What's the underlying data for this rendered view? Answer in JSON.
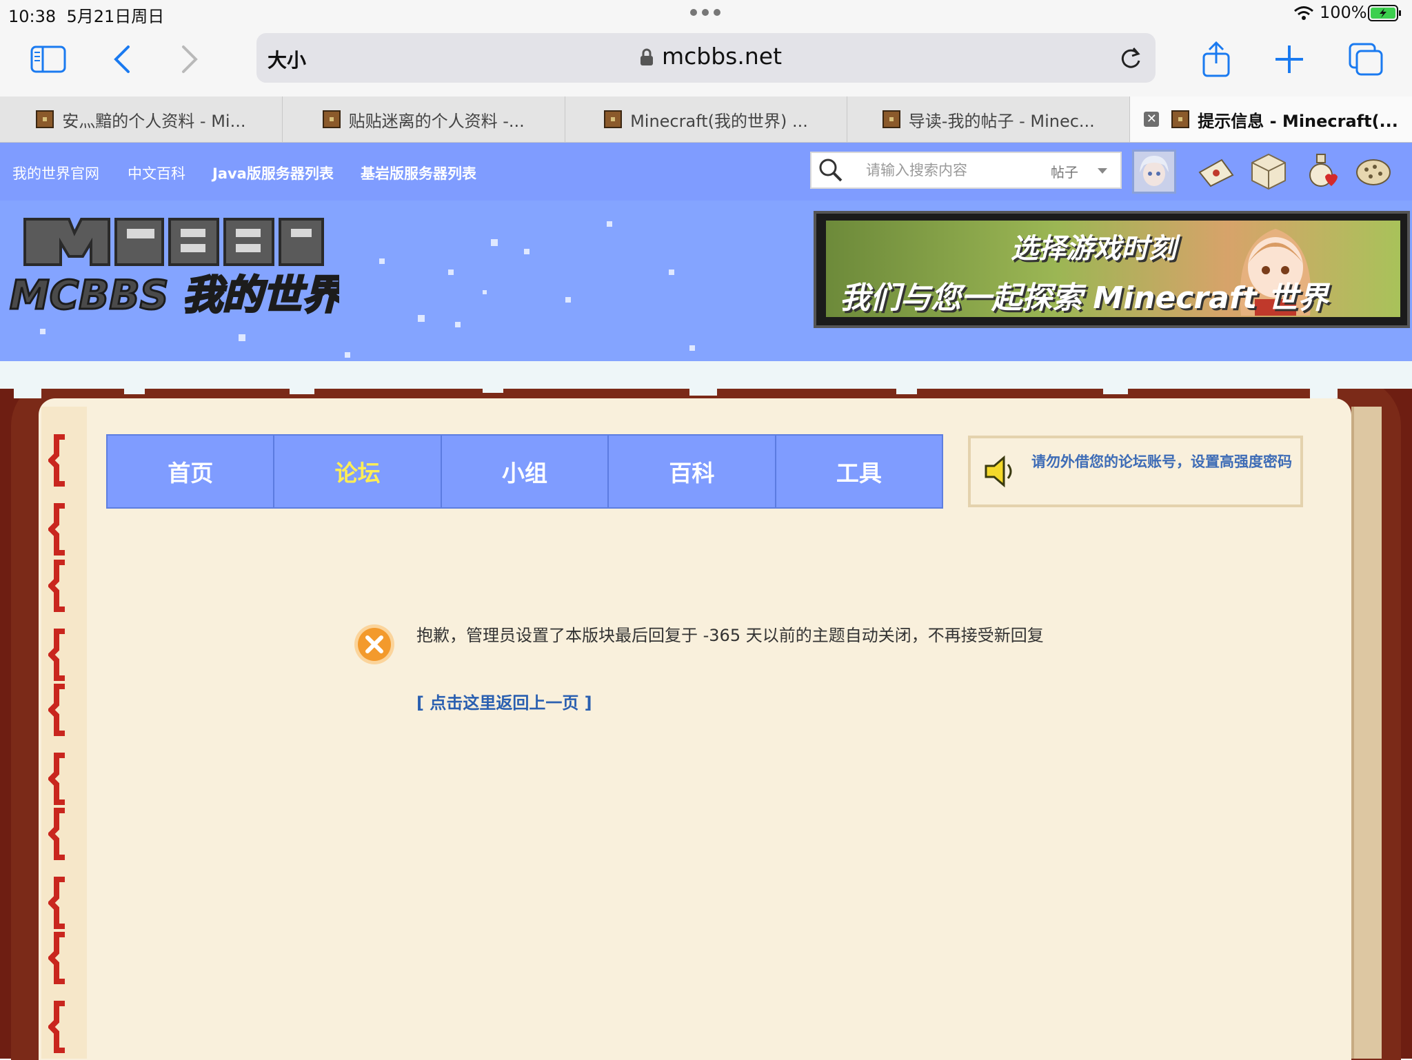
{
  "status_bar": {
    "time": "10:38",
    "date": "5月21日周日",
    "battery": "100%"
  },
  "browser": {
    "text_size_label": "大小",
    "url": "mcbbs.net"
  },
  "tabs": [
    {
      "title": "安灬黯的个人资料 - Mi..."
    },
    {
      "title": "贴贴迷离的个人资料 -..."
    },
    {
      "title": "Minecraft(我的世界) ..."
    },
    {
      "title": "导读-我的帖子 - Minec..."
    },
    {
      "title": "提示信息 - Minecraft(..."
    }
  ],
  "site_nav": {
    "links": [
      "我的世界官网",
      "中文百科",
      "Java版服务器列表",
      "基岩版服务器列表"
    ],
    "search_placeholder": "请输入搜索内容",
    "search_type": "帖子"
  },
  "banner": {
    "logo_alt": "MCBBS 我的世界中文论坛",
    "promo_line1": "选择游戏时刻",
    "promo_line2": "我们与您一起探索 Minecraft 世界"
  },
  "main_nav": {
    "items": [
      "首页",
      "论坛",
      "小组",
      "百科",
      "工具"
    ],
    "current": "论坛"
  },
  "notice": {
    "text": "请勿外借您的论坛账号，设置高强度密码"
  },
  "message": {
    "text": "抱歉，管理员设置了本版块最后回复于 -365 天以前的主题自动关闭，不再接受新回复",
    "back_link": "[ 点击这里返回上一页 ]"
  },
  "colors": {
    "nav_blue": "#7f9cff",
    "nav_current": "#ffee55",
    "paper": "#f9f0dc",
    "frame": "#7b2a18",
    "link": "#2a5fb0",
    "error_orange": "#f39a2c"
  }
}
